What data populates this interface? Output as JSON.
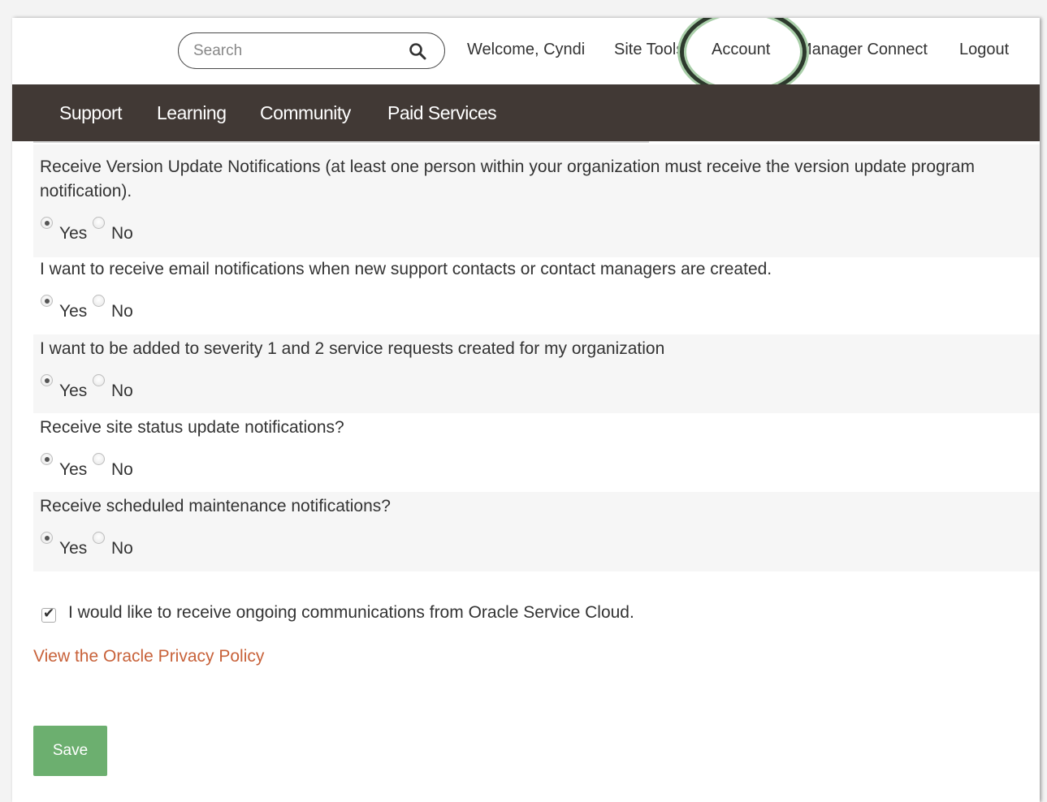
{
  "header": {
    "search_placeholder": "Search",
    "welcome": "Welcome, Cyndi",
    "site_tools": "Site Tools",
    "account": "Account",
    "manager_connect": "Manager Connect",
    "logout": "Logout"
  },
  "nav": {
    "items": [
      "Support",
      "Learning",
      "Community",
      "Paid Services"
    ]
  },
  "preferences": [
    {
      "question": "Receive Version Update Notifications (at least one person within your organization must receive the version update program notification).",
      "yes": "Yes",
      "no": "No",
      "selected": "Yes"
    },
    {
      "question": "I want to receive email notifications when new support contacts or contact managers are created.",
      "yes": "Yes",
      "no": "No",
      "selected": "Yes"
    },
    {
      "question": "I want to be added to severity 1 and 2 service requests created for my organization",
      "yes": "Yes",
      "no": "No",
      "selected": "Yes"
    },
    {
      "question": "Receive site status update notifications?",
      "yes": "Yes",
      "no": "No",
      "selected": "Yes"
    },
    {
      "question": "Receive scheduled maintenance notifications?",
      "yes": "Yes",
      "no": "No",
      "selected": "Yes"
    }
  ],
  "communications": {
    "label": "I would like to receive ongoing communications from Oracle Service Cloud.",
    "checked": true
  },
  "privacy_link": "View the Oracle Privacy Policy",
  "save_label": "Save",
  "colors": {
    "nav_bg": "#413935",
    "link": "#c8623a",
    "save_bg": "#6caf6f",
    "highlight_ring": "#a9cfa9"
  }
}
